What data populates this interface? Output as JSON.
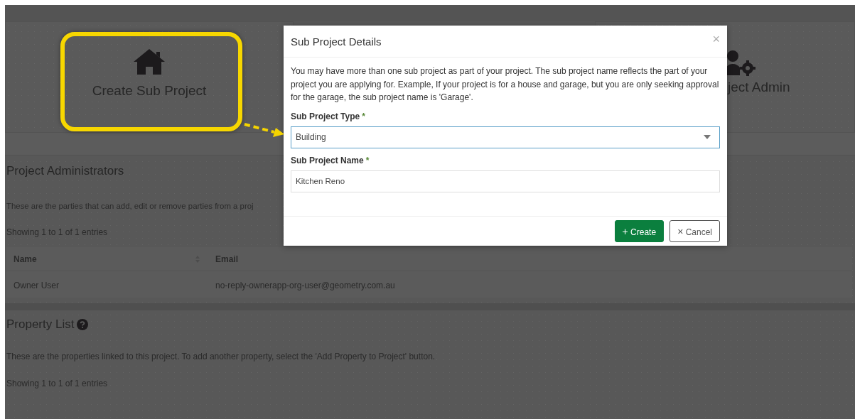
{
  "cards": [
    {
      "kind": "house",
      "label": "Create Sub Project",
      "highlighted": true
    },
    {
      "kind": "user-gear",
      "label": "ject Admin",
      "highlighted": false
    }
  ],
  "administrators": {
    "title": "Project Administrators",
    "description": "These are the parties that can add, edit or remove parties from a proj",
    "entries_info": "Showing 1 to 1 of 1 entries",
    "table": {
      "columns": [
        {
          "label": "Name",
          "sortable": true
        },
        {
          "label": "Email",
          "sortable": false
        }
      ],
      "rows": [
        [
          "Owner User",
          "no-reply-ownerapp-org-user@geometry.com.au"
        ]
      ]
    }
  },
  "property_list": {
    "title": "Property List",
    "help_icon": true,
    "description": "These are the properties linked to this project. To add another property, select the 'Add Property to Project' button.",
    "entries_info": "Showing 1 to 1 of 1 entries"
  },
  "modal": {
    "title": "Sub Project Details",
    "close": "×",
    "description": "You may have more than one sub project as part of your project. The sub project name reflects the part of your project you are applying for. Example, If your project is for a house and garage, but you are only seeking approval for the garage, the sub project name is 'Garage'.",
    "fields": [
      {
        "kind": "select",
        "label": "Sub Project Type",
        "required_mark": "*",
        "value": "Building",
        "focused": true
      },
      {
        "kind": "text",
        "label": "Sub Project Name",
        "required_mark": "*",
        "value": "Kitchen Reno",
        "focused": false
      }
    ],
    "buttons": [
      {
        "kind": "primary",
        "icon": "+",
        "label": "Create"
      },
      {
        "kind": "secondary",
        "icon": "×",
        "label": "Cancel"
      }
    ]
  }
}
